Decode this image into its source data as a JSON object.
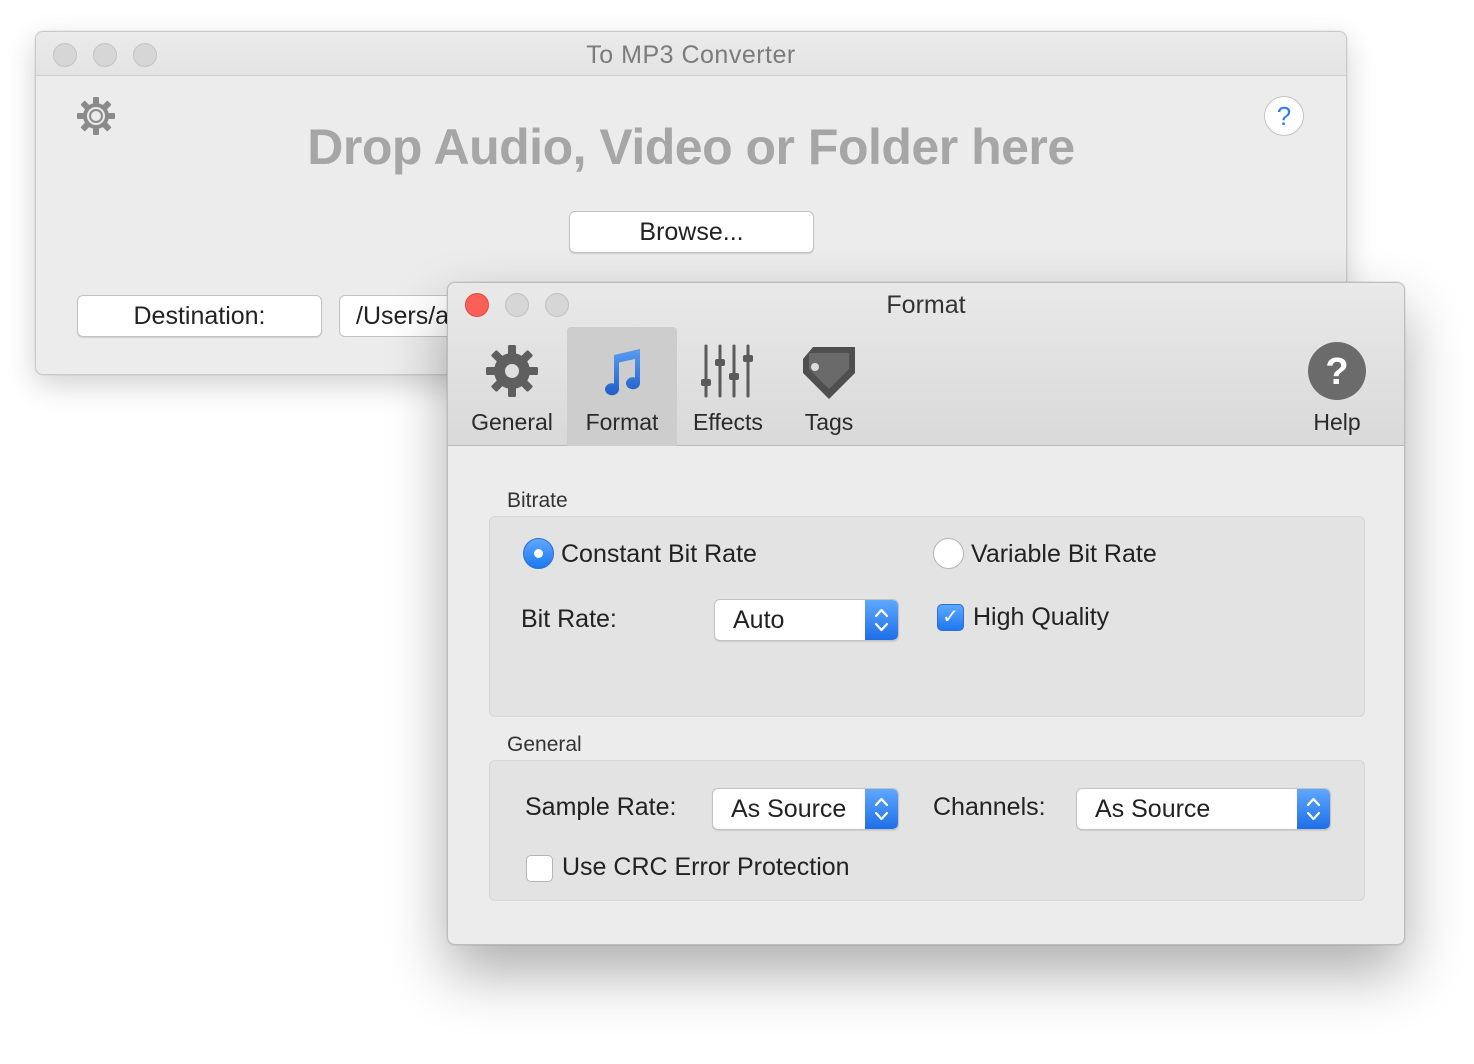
{
  "main_window": {
    "title": "To MP3 Converter",
    "drop_text": "Drop Audio, Video or Folder here",
    "browse_label": "Browse...",
    "destination_label": "Destination:",
    "destination_path": "/Users/a",
    "help_glyph": "?",
    "icons": [
      "gear-icon",
      "help-icon"
    ]
  },
  "format_window": {
    "title": "Format",
    "toolbar": {
      "general": "General",
      "format": "Format",
      "effects": "Effects",
      "tags": "Tags",
      "help": "Help"
    },
    "selected_tab": "Format",
    "bitrate_section": {
      "label": "Bitrate",
      "constant_label": "Constant Bit Rate",
      "variable_label": "Variable Bit Rate",
      "bitrate_mode": "Constant Bit Rate",
      "bit_rate_label": "Bit Rate:",
      "bit_rate_value": "Auto",
      "high_quality_label": "High Quality",
      "high_quality_checked": true
    },
    "general_section": {
      "label": "General",
      "sample_rate_label": "Sample Rate:",
      "sample_rate_value": "As Source",
      "channels_label": "Channels:",
      "channels_value": "As Source",
      "crc_label": "Use CRC Error Protection",
      "crc_checked": false
    }
  },
  "colors": {
    "accent_blue": "#2f7bf5",
    "close_red": "#fc5f57",
    "drop_text_gray": "#a6a6a6"
  }
}
